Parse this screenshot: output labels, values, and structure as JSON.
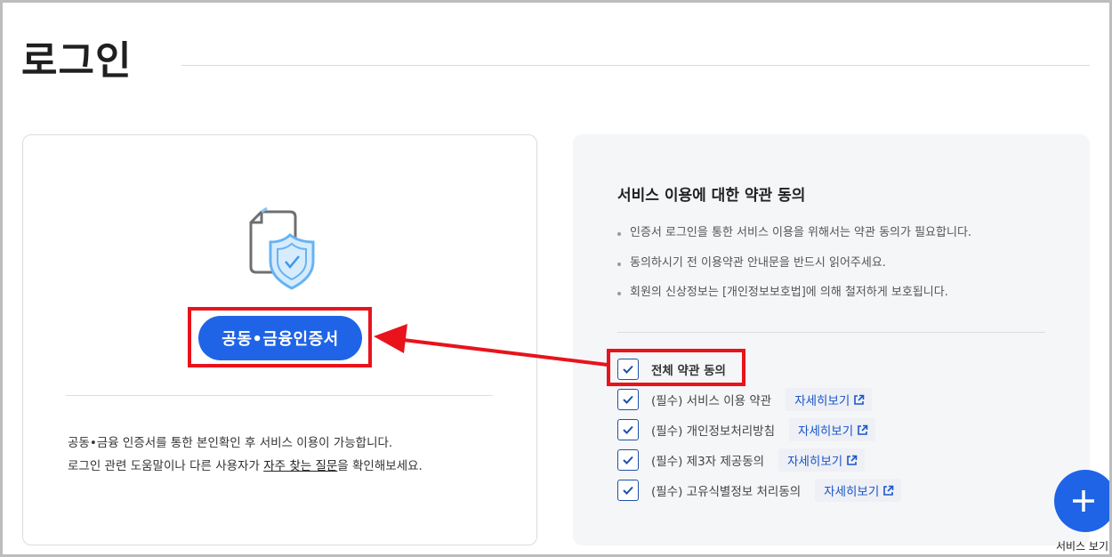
{
  "page": {
    "title": "로그인"
  },
  "login_card": {
    "cert_button_label": "공동•금융인증서",
    "desc_line1": "공동•금융 인증서를 통한 본인확인 후 서비스 이용이 가능합니다.",
    "desc_line2_prefix": "로그인 관련 도움말이나 다른 사용자가 ",
    "desc_line2_link": "자주 찾는 질문",
    "desc_line2_suffix": "을 확인해보세요."
  },
  "terms": {
    "title": "서비스 이용에 대한 약관 동의",
    "notices": [
      "인증서 로그인을 통한 서비스 이용을 위해서는 약관 동의가 필요합니다.",
      "동의하시기 전 이용약관 안내문을 반드시 읽어주세요.",
      "회원의 신상정보는 [개인정보보호법]에 의해 철저하게 보호됩니다."
    ],
    "all_agree_label": "전체 약관 동의",
    "detail_label": "자세히보기",
    "items": [
      {
        "label": "(필수) 서비스 이용 약관",
        "checked": true
      },
      {
        "label": "(필수) 개인정보처리방침",
        "checked": true
      },
      {
        "label": "(필수) 제3자 제공동의",
        "checked": true
      },
      {
        "label": "(필수) 고유식별정보 처리동의",
        "checked": true
      }
    ]
  },
  "fab": {
    "label": "서비스 보기",
    "icon": "plus-icon"
  },
  "colors": {
    "primary": "#1f64e6",
    "highlight": "#e8131b",
    "panel_bg": "#f5f6f8",
    "link": "#1a56c9"
  }
}
